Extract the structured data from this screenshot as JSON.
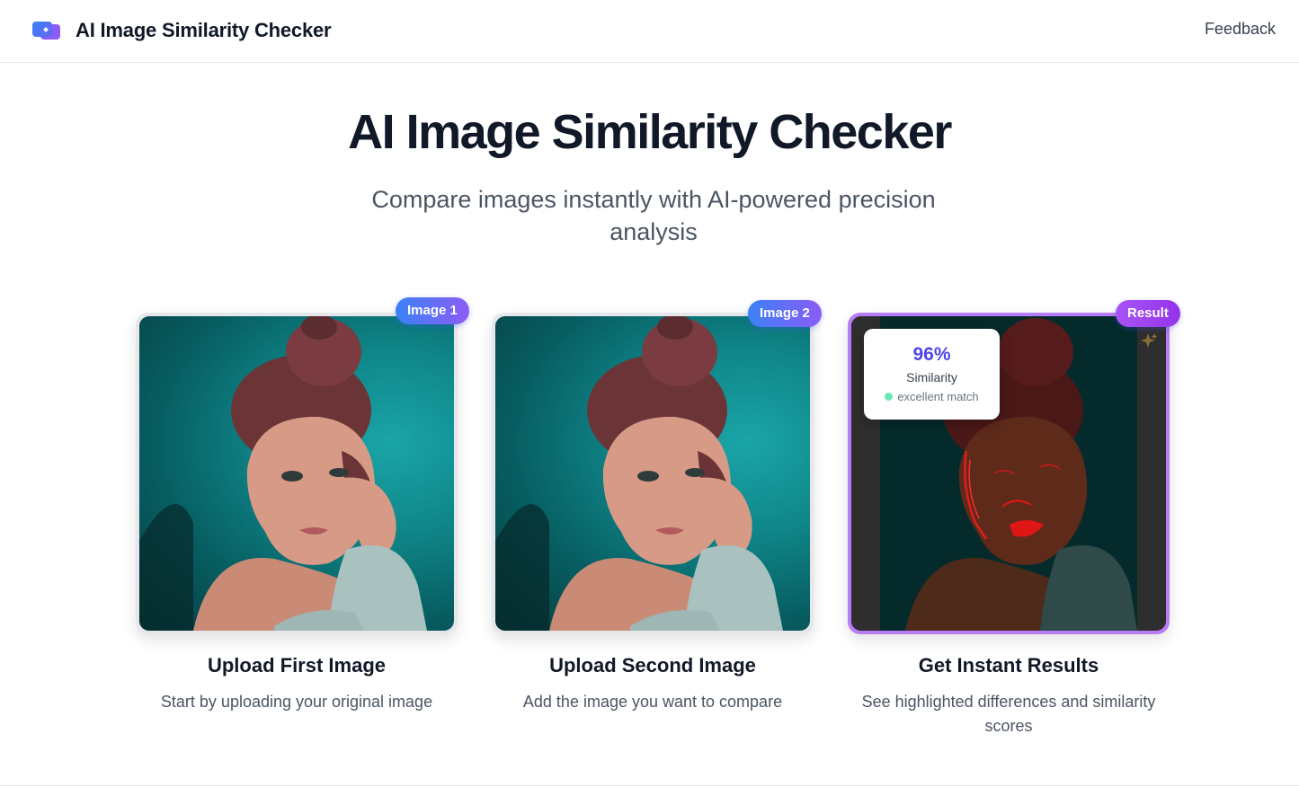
{
  "header": {
    "app_title": "AI Image Similarity Checker",
    "logo_icon": "overlapping-images-logo-icon",
    "feedback_link": "Feedback"
  },
  "hero": {
    "title": "AI Image Similarity Checker",
    "subtitle": "Compare images instantly with AI-powered precision analysis"
  },
  "steps": [
    {
      "badge": "Image 1",
      "title": "Upload First Image",
      "description": "Start by uploading your original image",
      "image_description": "portrait-photo"
    },
    {
      "badge": "Image 2",
      "title": "Upload Second Image",
      "description": "Add the image you want to compare",
      "image_description": "portrait-photo"
    },
    {
      "badge": "Result",
      "title": "Get Instant Results",
      "description": "See highlighted differences and similarity scores",
      "image_description": "difference-overlay"
    }
  ],
  "result": {
    "similarity_value": "96%",
    "similarity_label": "Similarity",
    "match_text": "excellent match",
    "match_color": "#6ee7b7",
    "sparkle_icon": "sparkle-icon"
  },
  "colors": {
    "accent_gradient_start": "#3b82f6",
    "accent_gradient_end": "#8b5cf6",
    "result_border": "#b77cf7",
    "score_text": "#4f46e5"
  }
}
